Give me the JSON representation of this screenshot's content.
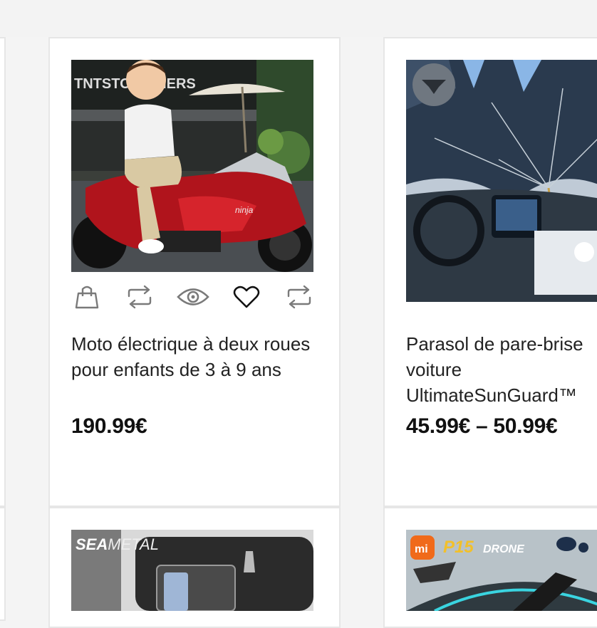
{
  "products": [
    {
      "title": "Moto électrique à deux roues pour enfants de 3 à 9 ans",
      "price": "190.99€"
    },
    {
      "title": "Parasol de pare-brise voiture UltimateSunGuard™",
      "price": "45.99€ – 50.99€"
    }
  ],
  "next_row_images": [
    {
      "brand_text": "SEAMETAL"
    },
    {
      "brand_text": "P15 DRONE"
    }
  ],
  "actions": [
    "bag-icon",
    "compare-icon",
    "eye-icon",
    "heart-icon",
    "compare-icon"
  ],
  "colors": {
    "background": "#f4f4f4",
    "card": "#ffffff",
    "border": "#e6e6e6",
    "text": "#222222",
    "icon": "#7a7a7a"
  }
}
